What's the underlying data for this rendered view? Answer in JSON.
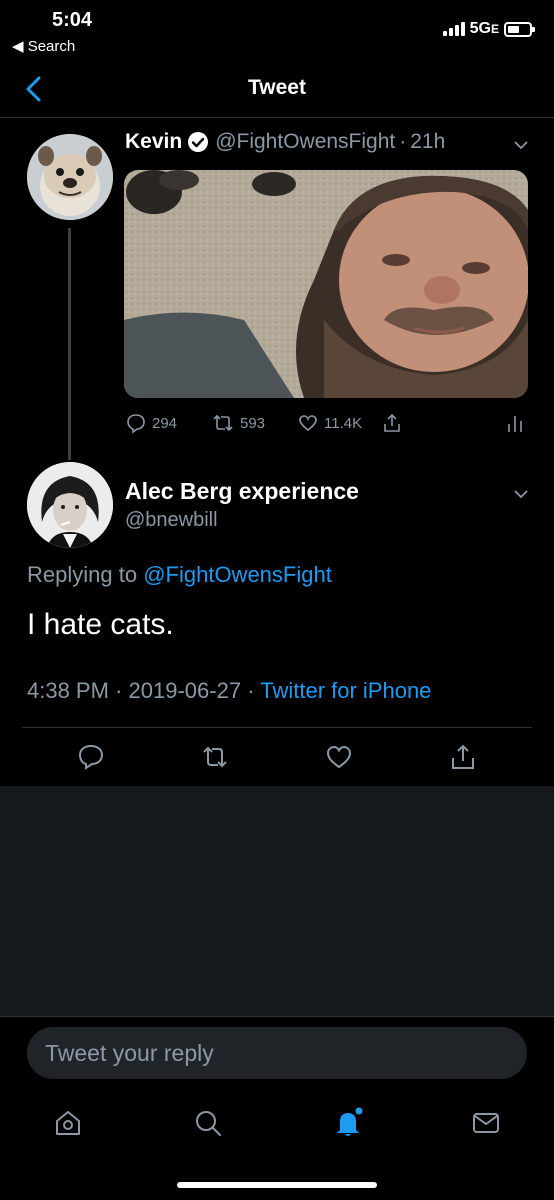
{
  "status_bar": {
    "time": "5:04",
    "back_label": "◀ Search",
    "network": "5G",
    "network_suffix": "E"
  },
  "nav": {
    "title": "Tweet"
  },
  "parent_tweet": {
    "author_name": "Kevin",
    "author_handle": "@FightOwensFight",
    "separator": "·",
    "age": "21h",
    "verified": true,
    "stats": {
      "replies": "294",
      "retweets": "593",
      "likes": "11.4K"
    }
  },
  "reply_tweet": {
    "author_name": "Alec Berg experience",
    "author_handle": "@bnewbill",
    "replying_prefix": "Replying to",
    "replying_to": "@FightOwensFight",
    "text": "I hate cats.",
    "time": "4:38 PM",
    "date": "2019-06-27",
    "separator": "·",
    "source": "Twitter for iPhone"
  },
  "composer": {
    "placeholder": "Tweet your reply"
  },
  "colors": {
    "accent": "#1d9bf0",
    "secondary_text": "#8b98a5",
    "background": "#000000",
    "panel": "#15181c"
  },
  "tabs": [
    "home-icon",
    "search-icon",
    "notifications-icon",
    "messages-icon"
  ]
}
